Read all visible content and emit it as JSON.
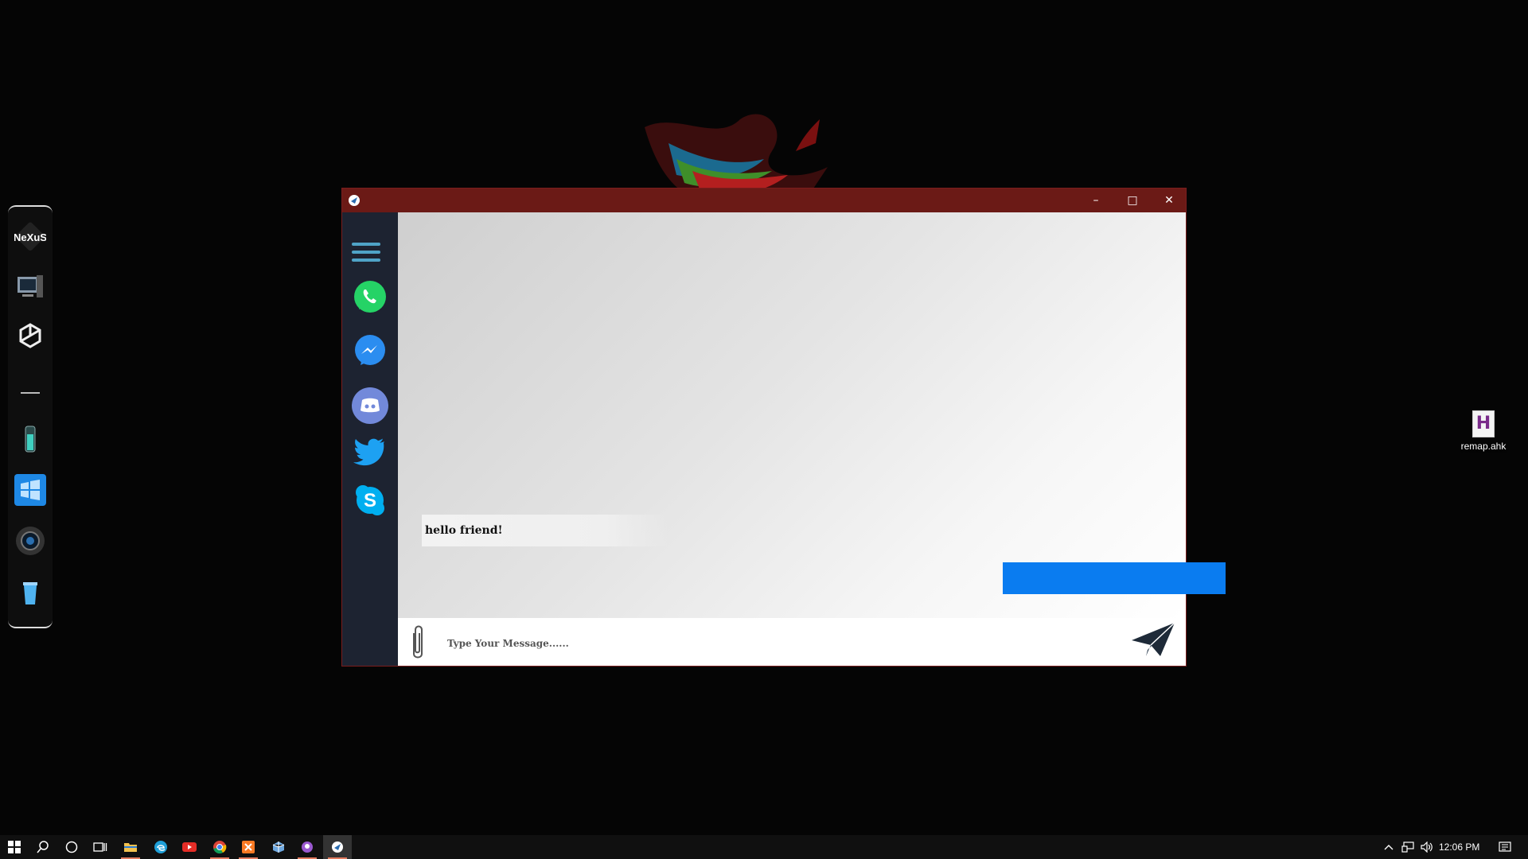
{
  "window": {
    "title": "",
    "minimize_glyph": "–",
    "maximize_glyph": "□",
    "close_glyph": "✕"
  },
  "sidebar": {
    "apps": [
      {
        "name": "whatsapp",
        "color": "#25d366"
      },
      {
        "name": "messenger",
        "color": "#2b8df0"
      },
      {
        "name": "discord",
        "color": "#7289da"
      },
      {
        "name": "twitter",
        "color": "#1da1f2"
      },
      {
        "name": "skype",
        "color": "#00aff0"
      }
    ]
  },
  "chat": {
    "messages": [
      {
        "direction": "incoming",
        "text": "hello friend!"
      },
      {
        "direction": "outgoing",
        "text": ""
      }
    ]
  },
  "composer": {
    "placeholder": "Type Your Message......"
  },
  "desktop": {
    "icon_label": "remap.ahk",
    "icon_glyph": "H"
  },
  "dock": {
    "nexus_label": "NeXuS"
  },
  "taskbar": {
    "time": "12:06 PM"
  },
  "colors": {
    "titlebar": "#6b1a16",
    "sidebar": "#1d2331",
    "outgoing_bubble": "#0a7cf0",
    "hamburger": "#4fa3c7"
  }
}
